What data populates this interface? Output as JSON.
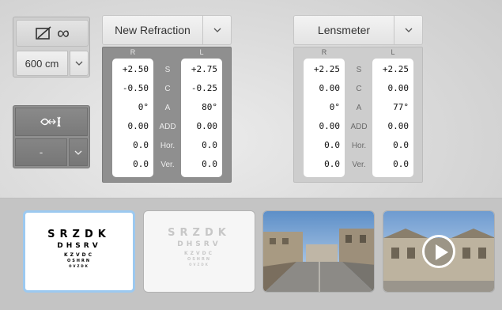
{
  "mode": {
    "icon": "split-view-infinity-icon"
  },
  "distance": {
    "value": "600 cm"
  },
  "eye": {
    "icon": "eye-lens-icon",
    "value": "-"
  },
  "refraction": {
    "title": "New Refraction",
    "headers": {
      "right": "R",
      "left": "L"
    },
    "labels": [
      "S",
      "C",
      "A",
      "ADD",
      "Hor.",
      "Ver."
    ],
    "right": [
      "+2.50",
      "-0.50",
      "0°",
      "0.00",
      "0.0",
      "0.0"
    ],
    "left": [
      "+2.75",
      "-0.25",
      "80°",
      "0.00",
      "0.0",
      "0.0"
    ]
  },
  "lensmeter": {
    "title": "Lensmeter",
    "headers": {
      "right": "R",
      "left": "L"
    },
    "labels": [
      "S",
      "C",
      "A",
      "ADD",
      "Hor.",
      "Ver."
    ],
    "right": [
      "+2.25",
      "0.00",
      "0°",
      "0.00",
      "0.0",
      "0.0"
    ],
    "left": [
      "+2.25",
      "0.00",
      "77°",
      "0.00",
      "0.0",
      "0.0"
    ]
  },
  "thumbnails": {
    "chart_lines": [
      "SRZDK",
      "DHSRV",
      "KZVDC",
      "OSHRN",
      "OVZDK"
    ],
    "scene_icon": "street-scene-image",
    "video_icon": "play-icon"
  },
  "colors": {
    "selected_border": "#9cc9f0"
  }
}
